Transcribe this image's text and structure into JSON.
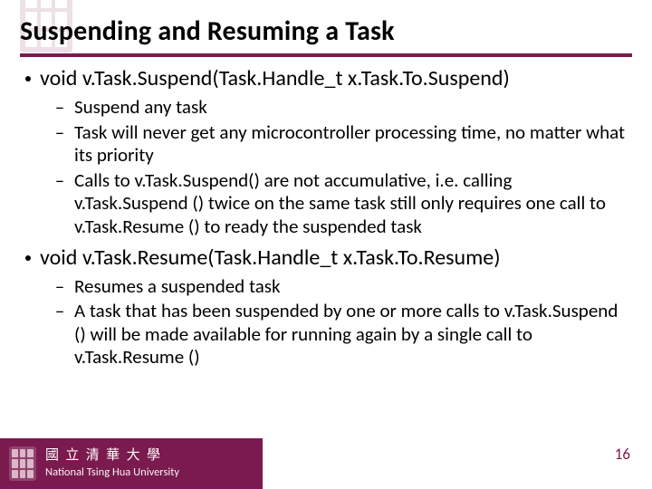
{
  "title": "Suspending and Resuming a Task",
  "bullets": [
    {
      "lead": "void v.Task.Suspend(Task.Handle_t x.Task.To.Suspend)",
      "sub": [
        "Suspend any task",
        "Task will never get any microcontroller processing time, no matter what its priority",
        "Calls to v.Task.Suspend() are not accumulative, i.e. calling v.Task.Suspend () twice on the same task still only requires one call to v.Task.Resume () to ready the suspended task"
      ]
    },
    {
      "lead": "void v.Task.Resume(Task.Handle_t x.Task.To.Resume)",
      "sub": [
        "Resumes a suspended task",
        "A task that has been suspended by one or more calls to v.Task.Suspend () will be made available for running again by a single call to v.Task.Resume ()"
      ]
    }
  ],
  "footer": {
    "cn": "國 立 清 華 大 學",
    "en": "National Tsing Hua University",
    "page": "16"
  }
}
